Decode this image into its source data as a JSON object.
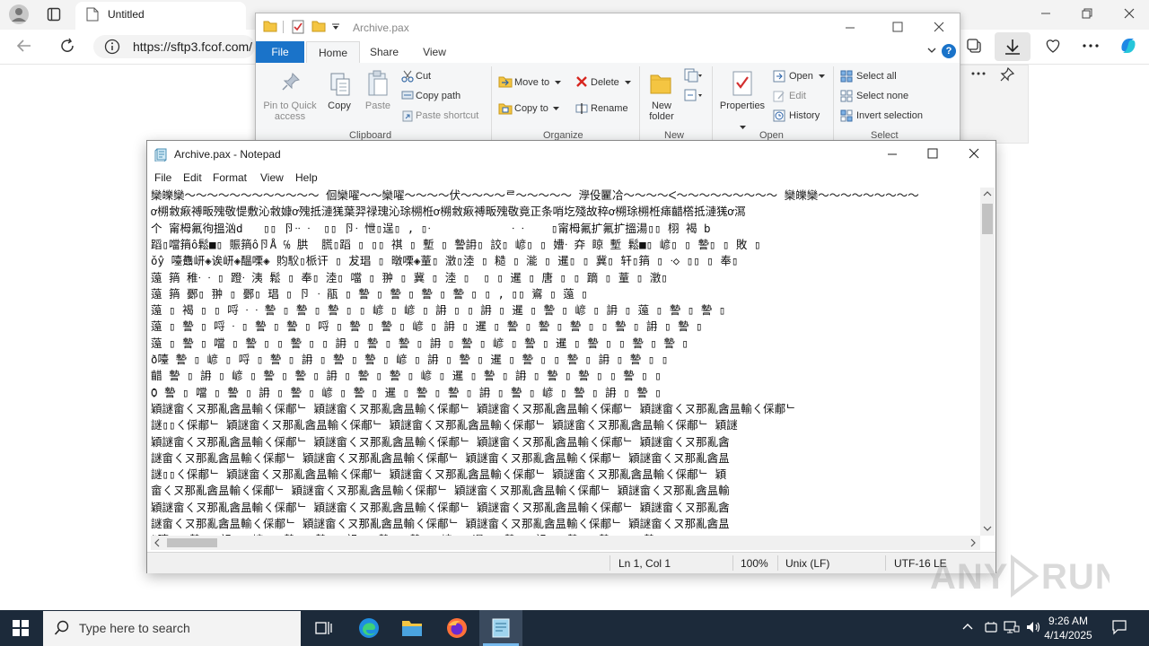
{
  "browser": {
    "tab_title": "Untitled",
    "url": "https://sftp3.fcof.com/"
  },
  "explorer": {
    "title": "Archive.pax",
    "tabs": {
      "file": "File",
      "home": "Home",
      "share": "Share",
      "view": "View"
    },
    "clipboard": {
      "pin": "Pin to Quick access",
      "copy": "Copy",
      "paste": "Paste",
      "cut": "Cut",
      "copy_path": "Copy path",
      "paste_shortcut": "Paste shortcut",
      "label": "Clipboard"
    },
    "organize": {
      "move_to": "Move to",
      "copy_to": "Copy to",
      "delete": "Delete",
      "rename": "Rename",
      "label": "Organize"
    },
    "new": {
      "new_folder": "New folder",
      "label": "New"
    },
    "open": {
      "properties": "Properties",
      "open": "Open",
      "edit": "Edit",
      "history": "History",
      "label": "Open"
    },
    "select": {
      "select_all": "Select all",
      "select_none": "Select none",
      "invert": "Invert selection",
      "label": "Select"
    }
  },
  "notepad": {
    "title": "Archive.pax - Notepad",
    "menu": {
      "file": "File",
      "edit": "Edit",
      "format": "Format",
      "view": "View",
      "help": "Help"
    },
    "lines": [
      "欒皪欒～～～～～～～～～～～～ 佪欒嚁～～欒嚁～～～～伏～～～～ᄅ～～～～～ 㶅伇匷冾～～～～ᐸ～～～～～～～～～ 欒皪欒～～～～～～～～～",
      "ơ㮶敹㾭禣畈㱱敬惿敷沁敹嫝ơ㱱抵漣獇葉羿禄瑰沁㻌㮶栣ơ㮶敹㾭禣畈㱱敬竟正条哨圪殘故稡ơ㮶㻌㮶栣㾩齰㯚抵漣獇ơ㵼",
      "个 甯栂氟㣘搵汹d   ▯▯ 卪ᐧᐧ ᐧ  ▯▯ 卪ᐧ 怈▯逞▯ , ▯ᐧ            ᐧ ᐧ    ▯甯栂氟扩氟扩搵湯▯▯ 栩 褐 b",
      "蹈▯噹䈰ô鬆■▯ 賑䈰ô卪Å ℅ 㬴  㬻▯蹈 ▯ ▯▯ 祺 ▯ 塹 ▯ 謺䛁▯ 詨▯ 嵃▯ ▯ 㜖ᐧ 㚏 䁁 塹 鬆■▯ 嵃▯ ▯ 謺▯ ▯ 敗 ▯",
      "ǒŷ 㘆䨊岍◈诶岍◈醖㗚◈ 䝧䭸▯㭛讦 ▯ 犮琩 ▯ 暾㗚◈蕫▯ 澂▯淕 ▯ 糙 ▯ 㴰 ▯ 暹▯ ▯ 冀▯ 轩▯䈰 ▯ ᐧ◇ ▯▯ ▯ 奉▯",
      "䕂 䈰 稚ᐧ ᐧ ▯ 蹬ᐧ 洟 鬆 ▯ 奉▯ 淕▯ 噹 ▯ 翀 ▯ 冀 ▯ 淕 ▯  ▯ ▯ 暹 ▯ 唐 ▯ ▯ 蹢 ▯ 蕫 ▯ 澂▯",
      "䕂 䈰 鄾▯ 翀 ▯ 鄾▯ 琩 ▯ 卪 ᐧ 瓹 ▯ 謺 ▯ 謺 ▯ 謺 ▯ 謺 ▯ ▯ , ▯▯ 䳐 ▯ 䕂 ▯",
      "䕂 ▯ 褐 ▯ ▯ 哷 ᐧ ᐧ 謺 ▯ 謺 ▯ 謺 ▯ ▯ 嵃 ▯ 嵃 ▯ 䛁 ▯ ▯ 䛁 ▯ 暹 ▯ 謺 ▯ 嵃 ▯ 䛁 ▯ 䕂 ▯ 謺 ▯ 謺 ▯",
      "䕂 ▯ 謺 ▯ 哷 ᐧ ▯ 謺 ▯ 謺 ▯ 哷 ▯ 謺 ▯ 謺 ▯ 嵃 ▯ 䛁 ▯ 暹 ▯ 謺 ▯ 謺 ▯ 謺 ▯ ▯ 謺 ▯ 䛁 ▯ 謺 ▯",
      "䕂 ▯ 謺 ▯ 噹 ▯ 謺 ▯ ▯ 謺 ▯ ▯ 䛁 ▯ 謺 ▯ 謺 ▯ 䛁 ▯ 謺 ▯ 嵃 ▯ 謺 ▯ 暹 ▯ 謺 ▯ ▯ 謺 ▯ 謺 ▯",
      "ð㘆 謺 ▯ 嵃 ▯ 哷 ▯ 謺 ▯ 䛁 ▯ 謺 ▯ 謺 ▯ 嵃 ▯ 䛁 ▯ 謺 ▯ 暹 ▯ 謺 ▯ ▯ 謺 ▯ 䛁 ▯ 謺 ▯ ▯",
      "齰 謺 ▯ 䛁 ▯ 嵃 ▯ 謺 ▯ 謺 ▯ 䛁 ▯ 謺 ▯ 謺 ▯ 嵃 ▯ 暹 ▯ 謺 ▯ 䛁 ▯ 謺 ▯ 謺 ▯ ▯ 謺 ▯ ▯",
      "Ѻ 謺 ▯ 噹 ▯ 謺 ▯ 䛁 ▯ 謺 ▯ 嵃 ▯ 謺 ▯ 暹 ▯ 謺 ▯ 謺 ▯ 䛁 ▯ 謺 ▯ 嵃 ▯ 謺 ▯ 䛁 ▯ 謺 ▯",
      "穎謎畲ㄑㄡ那亂酓昷輸ㄑ倸郙ᄂ 穎謎畲ㄑㄡ那亂酓昷輸ㄑ倸郙ᄂ 穎謎畲ㄑㄡ那亂酓昷輸ㄑ倸郙ᄂ 穎謎畲ㄑㄡ那亂酓昷輸ㄑ倸郙ᄂ",
      "謎▯▯ㄑ倸郙ᄂ 穎謎畲ㄑㄡ那亂酓昷輸ㄑ倸郙ᄂ 穎謎畲ㄑㄡ那亂酓昷輸ㄑ倸郙ᄂ 穎謎畲ㄑㄡ那亂酓昷輸ㄑ倸郙ᄂ 穎謎",
      "穎謎畲ㄑㄡ那亂酓昷輸ㄑ倸郙ᄂ 穎謎畲ㄑㄡ那亂酓昷輸ㄑ倸郙ᄂ 穎謎畲ㄑㄡ那亂酓昷輸ㄑ倸郙ᄂ 穎謎畲ㄑㄡ那亂酓",
      "謎畲ㄑㄡ那亂酓昷輸ㄑ倸郙ᄂ 穎謎畲ㄑㄡ那亂酓昷輸ㄑ倸郙ᄂ 穎謎畲ㄑㄡ那亂酓昷輸ㄑ倸郙ᄂ 穎謎畲ㄑㄡ那亂酓昷",
      "謎▯▯ㄑ倸郙ᄂ 穎謎畲ㄑㄡ那亂酓昷輸ㄑ倸郙ᄂ 穎謎畲ㄑㄡ那亂酓昷輸ㄑ倸郙ᄂ 穎謎畲ㄑㄡ那亂酓昷輸ㄑ倸郙ᄂ 穎",
      "畲ㄑㄡ那亂酓昷輸ㄑ倸郙ᄂ 穎謎畲ㄑㄡ那亂酓昷輸ㄑ倸郙ᄂ 穎謎畲ㄑㄡ那亂酓昷輸ㄑ倸郙ᄂ 穎謎畲ㄑㄡ那亂酓昷輸",
      "穎謎畲ㄑㄡ那亂酓昷輸ㄑ倸郙ᄂ 穎謎畲ㄑㄡ那亂酓昷輸ㄑ倸郙ᄂ 穎謎畲ㄑㄡ那亂酓昷輸ㄑ倸郙ᄂ 穎謎畲ㄑㄡ那亂酓",
      "謎畲ㄑㄡ那亂酓昷輸ㄑ倸郙ᄂ 穎謎畲ㄑㄡ那亂酓昷輸ㄑ倸郙ᄂ 穎謎畲ㄑㄡ那亂酓昷輸ㄑ倸郙ᄂ 穎謎畲ㄑㄡ那亂酓昷",
      "ð㘆 ▯ 謺 ▯ 䛁 ▯ 嵃 ▯ 謺 ▯ 謺 ▯ 䛁 ▯ 謺 ▯ 謺 ▯ 嵃 ▯ 暹 ▯ 謺 ▯ 䛁 ▯ 謺 ▯ 謺 ▯ ▯ 謺 ▯"
    ],
    "status": {
      "position": "Ln 1, Col 1",
      "zoom": "100%",
      "eol": "Unix (LF)",
      "encoding": "UTF-16 LE"
    }
  },
  "taskbar": {
    "search_placeholder": "Type here to search",
    "time": "9:26 AM",
    "date": "4/14/2025"
  },
  "watermark": "ANY RUN"
}
